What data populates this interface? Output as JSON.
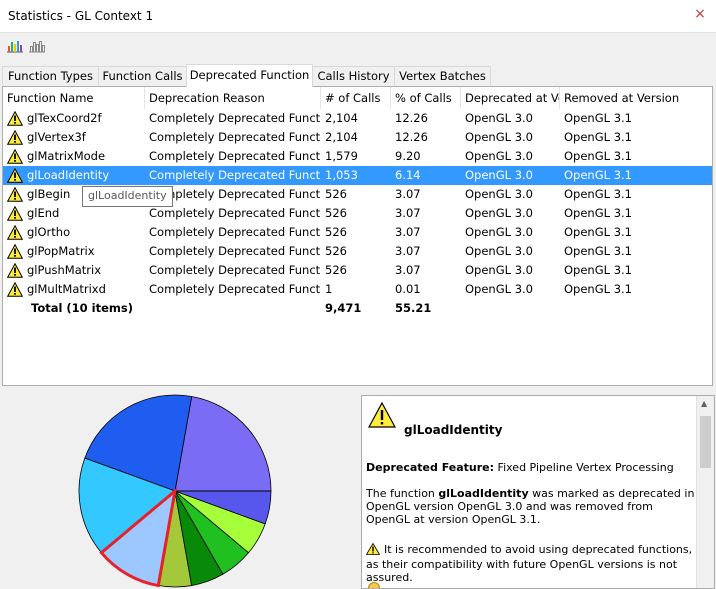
{
  "window": {
    "title": "Statistics - GL Context 1",
    "close_glyph": "×"
  },
  "toolbar": {
    "icons": [
      "bar-chart-icon",
      "bar-chart-outline-icon"
    ]
  },
  "tabs": [
    {
      "label": "Function Types",
      "active": false
    },
    {
      "label": "Function Calls",
      "active": false
    },
    {
      "label": "Deprecated Function",
      "active": true
    },
    {
      "label": "Calls History",
      "active": false
    },
    {
      "label": "Vertex Batches",
      "active": false
    }
  ],
  "table": {
    "columns": [
      "Function Name",
      "Deprecation Reason",
      "# of Calls",
      "% of Calls",
      "Deprecated at Ver",
      "Removed at Version"
    ],
    "rows": [
      {
        "name": "glTexCoord2f",
        "reason": "Completely Deprecated Functi...",
        "calls": "2,104",
        "pct": "12.26",
        "deprecated": "OpenGL 3.0",
        "removed": "OpenGL 3.1"
      },
      {
        "name": "glVertex3f",
        "reason": "Completely Deprecated Functi...",
        "calls": "2,104",
        "pct": "12.26",
        "deprecated": "OpenGL 3.0",
        "removed": "OpenGL 3.1"
      },
      {
        "name": "glMatrixMode",
        "reason": "Completely Deprecated Functi...",
        "calls": "1,579",
        "pct": "9.20",
        "deprecated": "OpenGL 3.0",
        "removed": "OpenGL 3.1"
      },
      {
        "name": "glLoadIdentity",
        "reason": "Completely Deprecated Functi...",
        "calls": "1,053",
        "pct": "6.14",
        "deprecated": "OpenGL 3.0",
        "removed": "OpenGL 3.1",
        "selected": true
      },
      {
        "name": "glBegin",
        "reason": "Completely Deprecated Functi...",
        "calls": "526",
        "pct": "3.07",
        "deprecated": "OpenGL 3.0",
        "removed": "OpenGL 3.1"
      },
      {
        "name": "glEnd",
        "reason": "Completely Deprecated Functi...",
        "calls": "526",
        "pct": "3.07",
        "deprecated": "OpenGL 3.0",
        "removed": "OpenGL 3.1"
      },
      {
        "name": "glOrtho",
        "reason": "Completely Deprecated Functi...",
        "calls": "526",
        "pct": "3.07",
        "deprecated": "OpenGL 3.0",
        "removed": "OpenGL 3.1"
      },
      {
        "name": "glPopMatrix",
        "reason": "Completely Deprecated Functi...",
        "calls": "526",
        "pct": "3.07",
        "deprecated": "OpenGL 3.0",
        "removed": "OpenGL 3.1"
      },
      {
        "name": "glPushMatrix",
        "reason": "Completely Deprecated Functi...",
        "calls": "526",
        "pct": "3.07",
        "deprecated": "OpenGL 3.0",
        "removed": "OpenGL 3.1"
      },
      {
        "name": "glMultMatrixd",
        "reason": "Completely Deprecated Functi...",
        "calls": "1",
        "pct": "0.01",
        "deprecated": "OpenGL 3.0",
        "removed": "OpenGL 3.1"
      }
    ],
    "total": {
      "label": "Total (10 items)",
      "calls": "9,471",
      "pct": "55.21"
    }
  },
  "tooltip": {
    "text": "glLoadIdentity"
  },
  "pie": {
    "highlight_color": "#e8202a",
    "slices": [
      {
        "label": "glTexCoord2f",
        "value": 2104,
        "color": "#7b6cf6"
      },
      {
        "label": "glVertex3f",
        "value": 2104,
        "color": "#1f5cf0"
      },
      {
        "label": "glMatrixMode",
        "value": 1579,
        "color": "#33c8ff"
      },
      {
        "label": "glLoadIdentity",
        "value": 1053,
        "color": "#9cc8ff",
        "highlight": true
      },
      {
        "label": "glBegin",
        "value": 526,
        "color": "#a3c93a"
      },
      {
        "label": "glEnd",
        "value": 526,
        "color": "#088a08"
      },
      {
        "label": "glOrtho",
        "value": 526,
        "color": "#1fc01f"
      },
      {
        "label": "glPopMatrix",
        "value": 526,
        "color": "#a6ff3a"
      },
      {
        "label": "glPushMatrix",
        "value": 526,
        "color": "#5757ee"
      },
      {
        "label": "glMultMatrixd",
        "value": 1,
        "color": "#0b0b7a"
      }
    ]
  },
  "info": {
    "title": "glLoadIdentity",
    "feature_label": "Deprecated Feature:",
    "feature_value": "Fixed Pipeline Vertex Processing",
    "desc_prefix": "The function ",
    "desc_name": "glLoadIdentity",
    "desc_suffix": " was marked as deprecated in OpenGL version OpenGL 3.0 and was removed from OpenGL at version OpenGL 3.1.",
    "recommendation": "It is recommended to avoid using deprecated functions, as their compatibility with future OpenGL versions is not assured."
  }
}
